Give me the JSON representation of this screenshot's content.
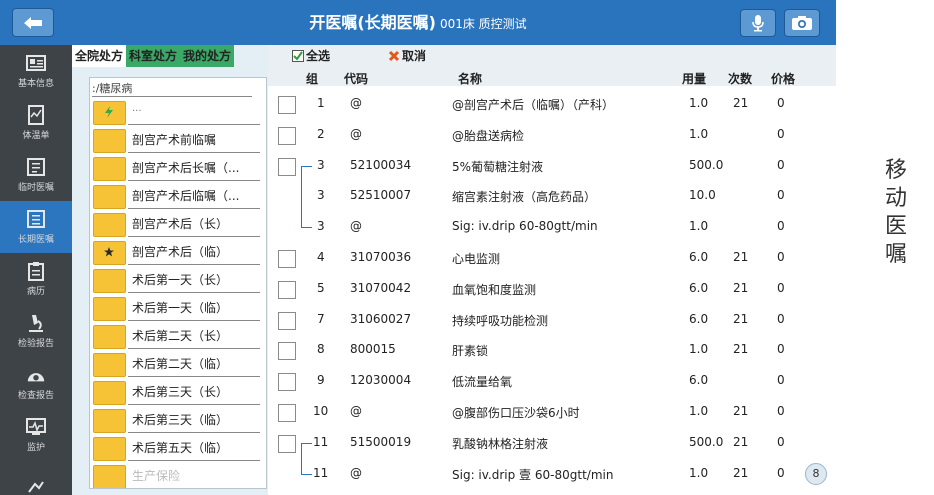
{
  "header": {
    "back_icon": "back-arrow-icon",
    "title": "开医嘱(长期医嘱)",
    "subtitle": "001床 质控测试",
    "mic_icon": "microphone-icon",
    "camera_icon": "camera-icon"
  },
  "sidebar": {
    "items": [
      {
        "label": "基本信息",
        "icon": "id-card-icon"
      },
      {
        "label": "体温单",
        "icon": "chart-doc-icon"
      },
      {
        "label": "临时医嘱",
        "icon": "temp-order-icon"
      },
      {
        "label": "长期医嘱",
        "icon": "long-order-icon"
      },
      {
        "label": "病历",
        "icon": "record-icon"
      },
      {
        "label": "检验报告",
        "icon": "microscope-icon"
      },
      {
        "label": "检查报告",
        "icon": "scanner-icon"
      },
      {
        "label": "监护",
        "icon": "monitor-icon"
      },
      {
        "label": "",
        "icon": "more-icon"
      }
    ],
    "active_index": 3
  },
  "left_panel": {
    "tabs": [
      "全院处方",
      "科室处方",
      "我的处方"
    ],
    "path": ":/糖尿病",
    "up_label": "...",
    "folders": [
      "剖宫产术前临嘱",
      "剖宫产术后长嘱（...",
      "剖宫产术后临嘱（...",
      "剖宫产术后（长）",
      "剖宫产术后（临）",
      "术后第一天（长）",
      "术后第一天（临）",
      "术后第二天（长）",
      "术后第二天（临）",
      "术后第三天（长）",
      "术后第三天（临）",
      "术后第五天（临）",
      "生产保险"
    ]
  },
  "toolbar": {
    "select_all": "全选",
    "cancel": "取消"
  },
  "table": {
    "columns": [
      "组",
      "代码",
      "名称",
      "用量",
      "次数",
      "价格"
    ],
    "rows": [
      {
        "group": "1",
        "code": "@",
        "name": "@剖宫产术后（临嘱）（产科）",
        "dose": "1.0",
        "times": "21",
        "price": "0",
        "checkbox": true,
        "bracket": ""
      },
      {
        "group": "2",
        "code": "@",
        "name": "@胎盘送病检",
        "dose": "1.0",
        "times": "",
        "price": "0",
        "checkbox": true,
        "bracket": ""
      },
      {
        "group": "3",
        "code": "52100034",
        "name": "5%葡萄糖注射液",
        "dose": "500.0",
        "times": "",
        "price": "0",
        "checkbox": true,
        "bracket": "top"
      },
      {
        "group": "3",
        "code": "52510007",
        "name": "缩宫素注射液（高危药品）",
        "dose": "10.0",
        "times": "",
        "price": "0",
        "checkbox": false,
        "bracket": "mid"
      },
      {
        "group": "3",
        "code": "@",
        "name": " Sig: iv.drip 60-80gtt/min",
        "dose": "1.0",
        "times": "",
        "price": "0",
        "checkbox": false,
        "bracket": "bot"
      },
      {
        "group": "4",
        "code": "31070036",
        "name": "心电监测",
        "dose": "6.0",
        "times": "21",
        "price": "0",
        "checkbox": true,
        "bracket": ""
      },
      {
        "group": "5",
        "code": "31070042",
        "name": "血氧饱和度监测",
        "dose": "6.0",
        "times": "21",
        "price": "0",
        "checkbox": true,
        "bracket": ""
      },
      {
        "group": "7",
        "code": "31060027",
        "name": "持续呼吸功能检测",
        "dose": "6.0",
        "times": "21",
        "price": "0",
        "checkbox": true,
        "bracket": ""
      },
      {
        "group": "8",
        "code": "800015",
        "name": "肝素锁",
        "dose": "1.0",
        "times": "21",
        "price": "0",
        "checkbox": true,
        "bracket": ""
      },
      {
        "group": "9",
        "code": "12030004",
        "name": "低流量给氧",
        "dose": "6.0",
        "times": "",
        "price": "0",
        "checkbox": true,
        "bracket": ""
      },
      {
        "group": "10",
        "code": "@",
        "name": "@腹部伤口压沙袋6小时",
        "dose": "1.0",
        "times": "21",
        "price": "0",
        "checkbox": true,
        "bracket": ""
      },
      {
        "group": "11",
        "code": "51500019",
        "name": "乳酸钠林格注射液",
        "dose": "500.0",
        "times": "21",
        "price": "0",
        "checkbox": true,
        "bracket": "top"
      },
      {
        "group": "11",
        "code": "@",
        "name": " Sig: iv.drip 壹 60-80gtt/min",
        "dose": "1.0",
        "times": "21",
        "price": "0",
        "checkbox": false,
        "bracket": "bot"
      }
    ]
  },
  "page_badge": "8",
  "side_caption": [
    "移",
    "动",
    "医",
    "嘱"
  ],
  "colors": {
    "topbar": "#2a74be",
    "sidebar": "#3e4347",
    "sidebar_active": "#2b76bf",
    "tab_green": "#3aa866",
    "folder": "#f6c236"
  }
}
